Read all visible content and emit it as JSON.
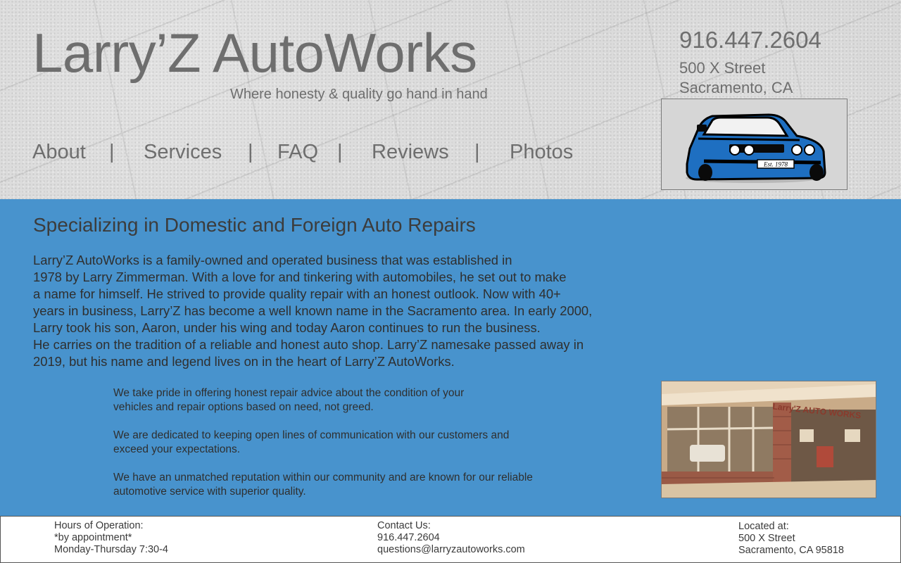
{
  "site": {
    "title": "Larry’Z AutoWorks",
    "tagline": "Where honesty & quality go hand in hand",
    "phone": "916.447.2604",
    "address_line1": "500 X Street",
    "address_line2": "Sacramento, CA",
    "logo_text": "Est. 1978"
  },
  "nav": {
    "items": [
      "About",
      "Services",
      "FAQ",
      "Reviews",
      "Photos"
    ],
    "separator": "|"
  },
  "main": {
    "heading": "Specializing in Domestic and Foreign Auto Repairs",
    "intro_lines": [
      "Larry’Z AutoWorks is a family-owned and operated business that was established in",
      "1978 by Larry Zimmerman. With a love for and tinkering with automobiles, he set out to make",
      "a name for himself. He strived to provide quality repair with an honest outlook. Now with 40+",
      "years in business, Larry’Z has become a well known name in the Sacramento area. In early 2000,",
      "Larry took his son, Aaron, under his wing and today Aaron continues to run the business.",
      "He carries on the tradition of a reliable and honest auto shop. Larry’Z namesake passed away in",
      "2019, but his name and legend lives on in the heart of Larry’Z AutoWorks."
    ],
    "pledges": [
      [
        "We take pride in offering honest repair advice about the condition of your",
        "vehicles and repair options based on need, not greed."
      ],
      [
        "We are dedicated to keeping open lines of communication with our customers and",
        "exceed your expectations."
      ],
      [
        "We have an unmatched reputation within our community and are known for our reliable",
        "automotive service with superior quality."
      ]
    ],
    "photo_sign": "Larry'Z AUTO WORKS"
  },
  "footer": {
    "hours_label": "Hours of Operation:",
    "hours_note": "*by appointment*",
    "hours_days": "Monday-Thursday 7:30-4",
    "contact_label": "Contact Us:",
    "contact_phone": "916.447.2604",
    "contact_email": "questions@larryzautoworks.com",
    "location_label": "Located at:",
    "location_line1": "500 X Street",
    "location_line2": "Sacramento, CA 95818"
  },
  "colors": {
    "main_bg": "#4893cd",
    "car_blue": "#1e6fc1",
    "text_gray": "#6e6e6e"
  }
}
